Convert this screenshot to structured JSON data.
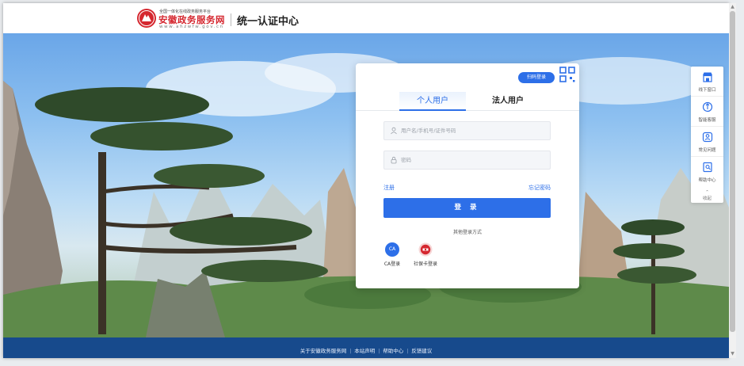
{
  "header": {
    "brand_small": "全国一体化在线政务服务平台",
    "brand_main": "安徽政务服务网",
    "brand_url": "www.ahzwfw.gov.cn",
    "system_title": "统一认证中心"
  },
  "login": {
    "qr_button": "扫码登录",
    "tabs": [
      {
        "label": "个人用户",
        "active": true
      },
      {
        "label": "法人用户",
        "active": false
      }
    ],
    "username_placeholder": "用户名/手机号/证件号码",
    "password_placeholder": "密码",
    "register_link": "注册",
    "forgot_link": "忘记密码",
    "submit": "登 录",
    "other_methods_label": "其他登录方式",
    "alt_methods": [
      {
        "label": "CA登录",
        "badge": "CA"
      },
      {
        "label": "社保卡登录",
        "badge": ""
      }
    ]
  },
  "sidebar": {
    "items": [
      {
        "label": "线下窗口",
        "icon": "store-icon"
      },
      {
        "label": "智能客服",
        "icon": "assistant-icon"
      },
      {
        "label": "常见问题",
        "icon": "faq-icon"
      },
      {
        "label": "帮助中心",
        "icon": "help-doc-icon"
      }
    ],
    "collapse_label": "收起"
  },
  "footer": {
    "links": [
      "关于安徽政务服务网",
      "本站声明",
      "帮助中心",
      "反馈建议"
    ],
    "separator": "|"
  },
  "colors": {
    "primary": "#2d6fe8",
    "brand_red": "#d5272f",
    "footer_bg": "#174a8c"
  }
}
